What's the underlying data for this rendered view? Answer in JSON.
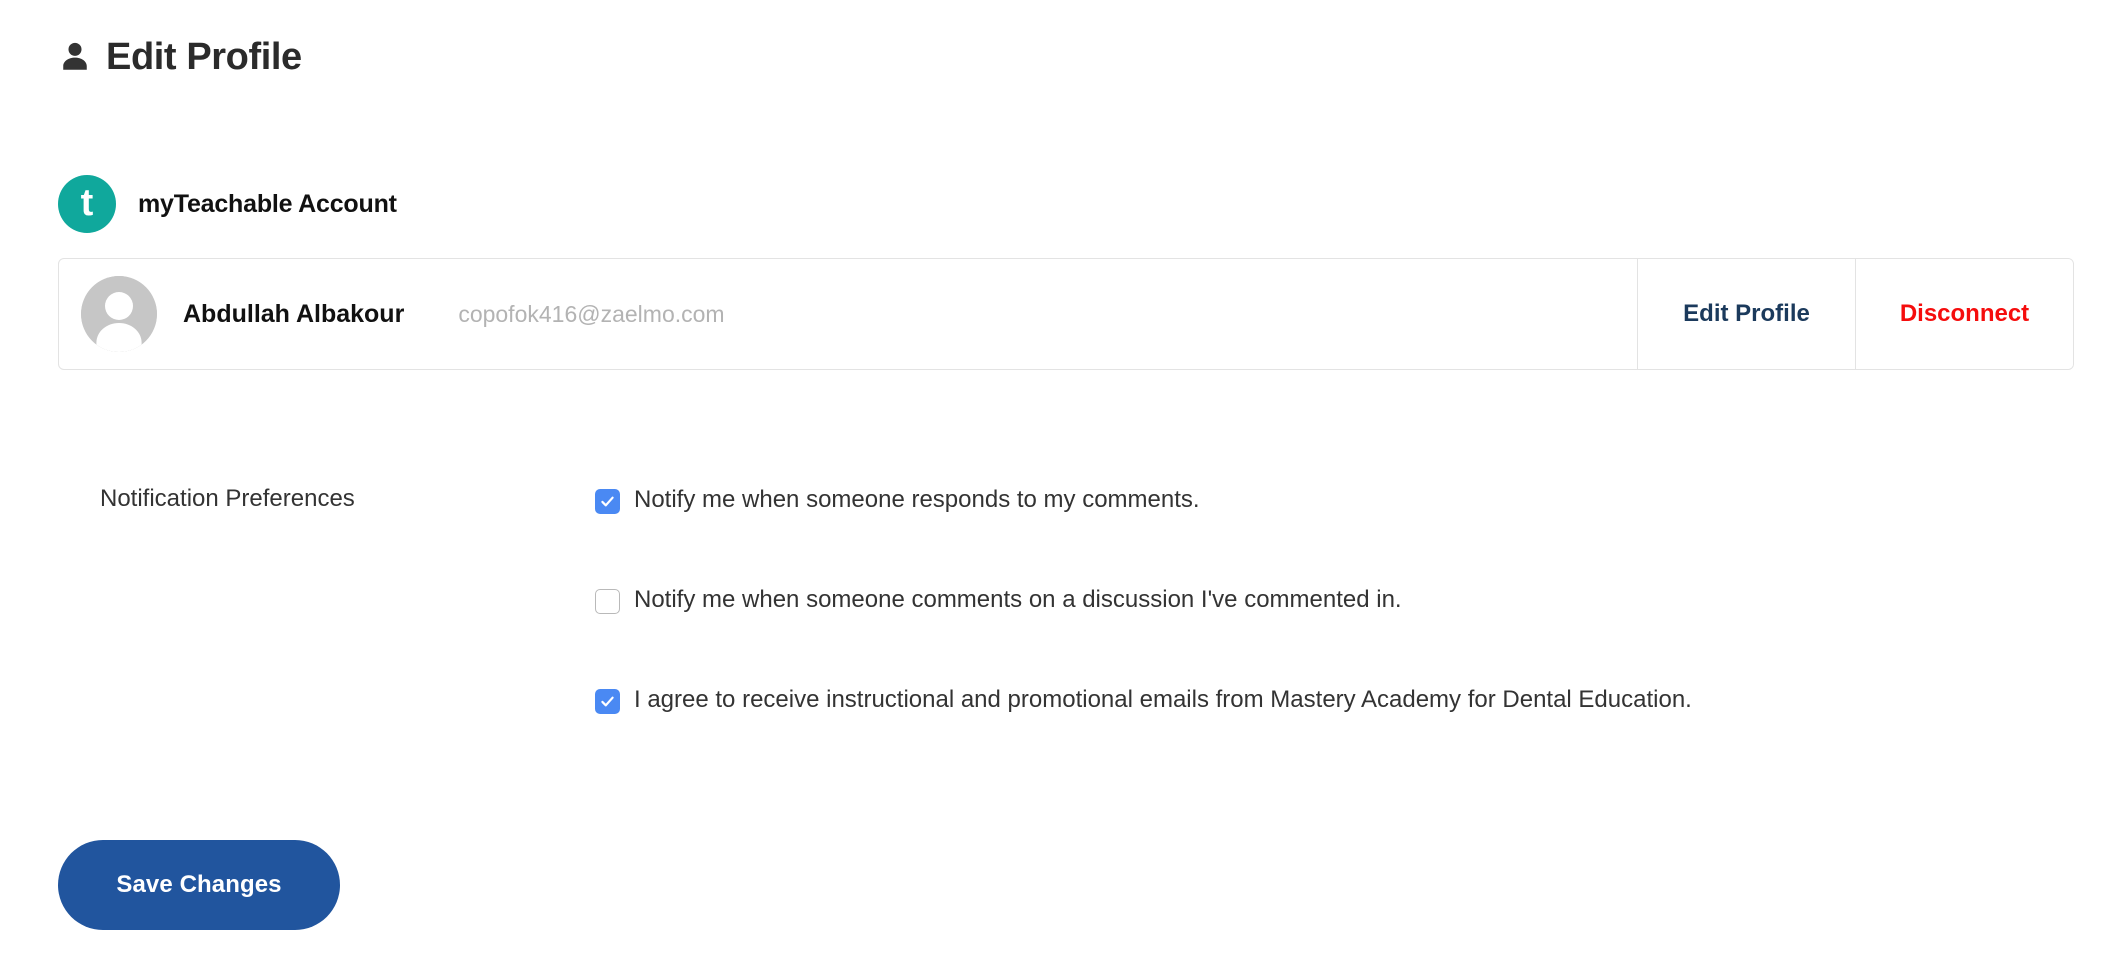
{
  "header": {
    "icon": "user-icon",
    "title": "Edit Profile"
  },
  "account_section": {
    "logo_letter": "t",
    "logo_color": "#10a89c",
    "heading": "myTeachable Account",
    "card": {
      "avatar": "avatar-placeholder-icon",
      "name": "Abdullah Albakour",
      "email": "copofok416@zaelmo.com",
      "actions": [
        {
          "label": "Edit Profile",
          "color": "#1b3a5c"
        },
        {
          "label": "Disconnect",
          "color": "#f50d0d"
        }
      ]
    }
  },
  "preferences": {
    "label": "Notification Preferences",
    "checked_color": "#4a89f3",
    "items": [
      {
        "label": "Notify me when someone responds to my comments.",
        "checked": true
      },
      {
        "label": "Notify me when someone comments on a discussion I've commented in.",
        "checked": false
      },
      {
        "label": "I agree to receive instructional and promotional emails from Mastery Academy for Dental Education.",
        "checked": true
      }
    ]
  },
  "footer": {
    "save_label": "Save Changes",
    "save_color": "#21559e"
  }
}
